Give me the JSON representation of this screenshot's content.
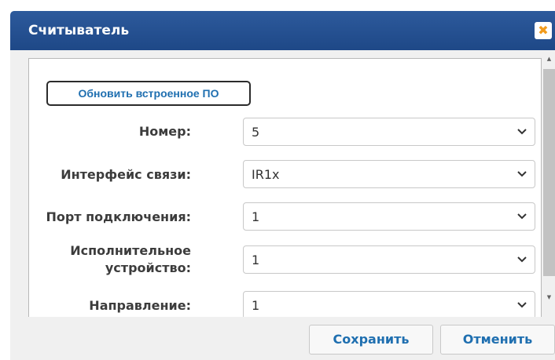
{
  "dialog": {
    "title": "Считыватель",
    "close_icon": "close-icon"
  },
  "firmware_button": {
    "label": "Обновить встроенное ПО"
  },
  "fields": {
    "number": {
      "label": "Номер:",
      "value": "5"
    },
    "interface": {
      "label": "Интерфейс связи:",
      "value": "IR1x"
    },
    "port": {
      "label": "Порт подключения:",
      "value": "1"
    },
    "device": {
      "label_line1": "Исполнительное",
      "label_line2": "устройство:",
      "value": "1"
    },
    "direction": {
      "label": "Направление:",
      "value": "1"
    }
  },
  "footer": {
    "save_label": "Сохранить",
    "cancel_label": "Отменить"
  }
}
